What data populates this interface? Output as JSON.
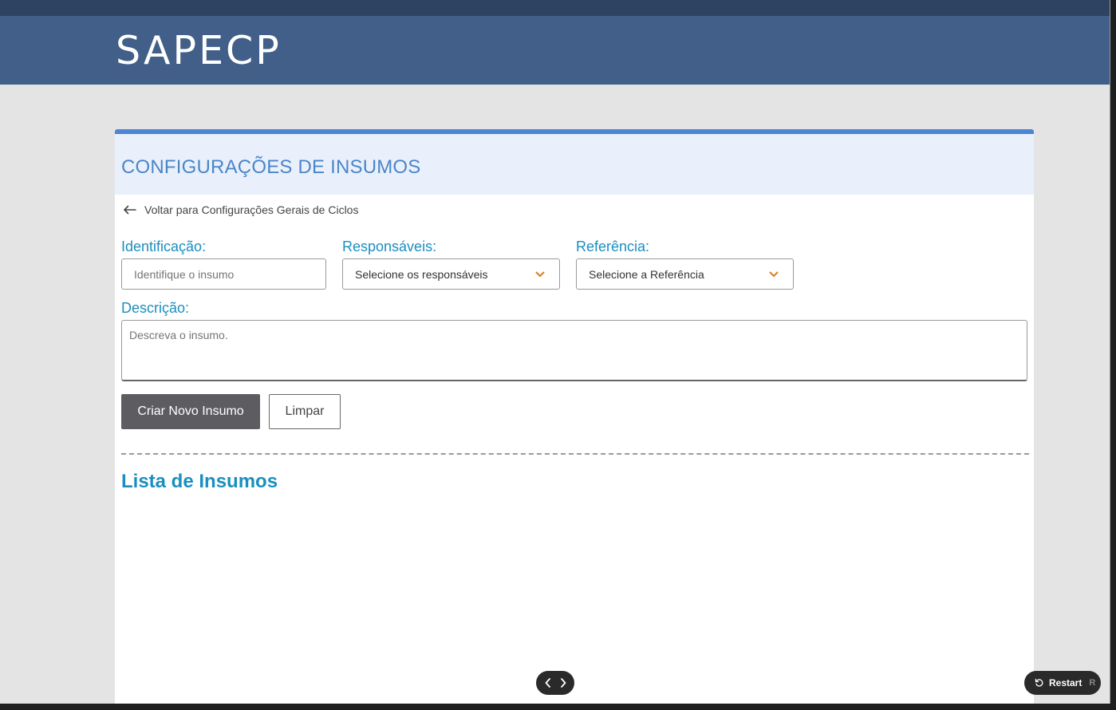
{
  "app": {
    "logo": "SAPECP"
  },
  "page": {
    "title": "CONFIGURAÇÕES DE INSUMOS",
    "back_link": "Voltar para Configurações Gerais de Ciclos"
  },
  "form": {
    "identificacao": {
      "label": "Identificação:",
      "placeholder": "Identifique o insumo"
    },
    "responsaveis": {
      "label": "Responsáveis:",
      "value": "Selecione os responsáveis"
    },
    "referencia": {
      "label": "Referência:",
      "value": "Selecione a Referência"
    },
    "descricao": {
      "label": "Descrição:",
      "placeholder": "Descreva o insumo."
    },
    "create_button": "Criar Novo Insumo",
    "clear_button": "Limpar"
  },
  "list": {
    "title": "Lista de Insumos"
  },
  "overlay": {
    "restart_label": "Restart",
    "restart_key": "R",
    "prev_icon": "chevron-left-icon",
    "next_icon": "chevron-right-icon"
  },
  "colors": {
    "header_bg": "#415f88",
    "accent": "#4a86d4",
    "label": "#1a8fbf",
    "chevron": "#e07b1f",
    "primary_button": "#5d5d61"
  }
}
